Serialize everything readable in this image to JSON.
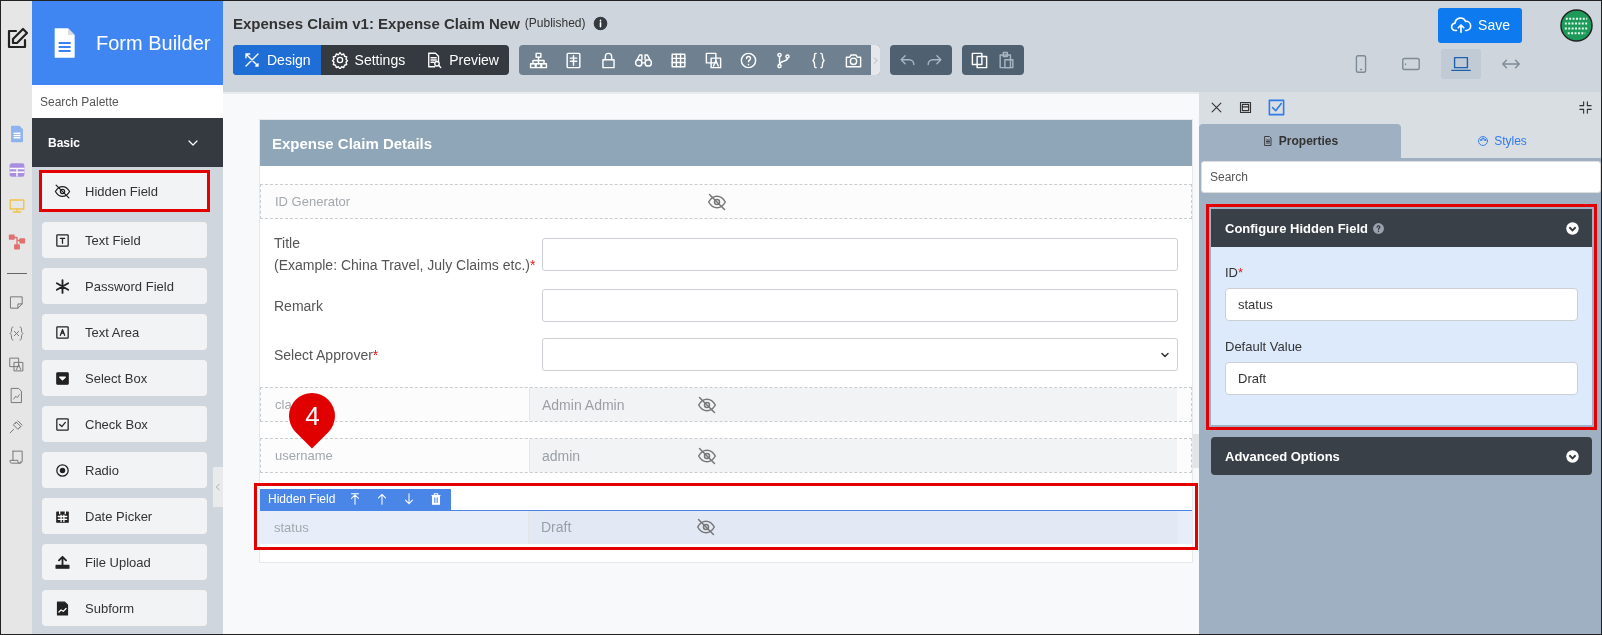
{
  "palette": {
    "title": "Form Builder",
    "search_placeholder": "Search Palette",
    "category": "Basic",
    "items": [
      {
        "label": "Hidden Field",
        "selected": true
      },
      {
        "label": "Text Field",
        "selected": false
      },
      {
        "label": "Password Field",
        "selected": false
      },
      {
        "label": "Text Area",
        "selected": false
      },
      {
        "label": "Select Box",
        "selected": false
      },
      {
        "label": "Check Box",
        "selected": false
      },
      {
        "label": "Radio",
        "selected": false
      },
      {
        "label": "Date Picker",
        "selected": false
      },
      {
        "label": "File Upload",
        "selected": false
      },
      {
        "label": "Subform",
        "selected": false
      }
    ]
  },
  "header": {
    "title": "Expenses Claim v1: Expense Claim New",
    "status": "(Published)"
  },
  "mode_tabs": [
    {
      "label": "Design",
      "selected": true
    },
    {
      "label": "Settings",
      "selected": false
    },
    {
      "label": "Preview",
      "selected": false
    }
  ],
  "save_button": "Save",
  "device_views": [
    {
      "kind": "phone",
      "selected": false
    },
    {
      "kind": "tablet",
      "selected": false
    },
    {
      "kind": "laptop",
      "selected": true
    },
    {
      "kind": "full-width",
      "selected": false
    }
  ],
  "form": {
    "section_title": "Expense Claim Details",
    "selection_toolbar": "Hidden Field",
    "fields": [
      {
        "kind": "hidden",
        "label": "ID Generator",
        "selected": false
      },
      {
        "kind": "text",
        "label": "Title",
        "hint": "(Example: China Travel, July Claims etc.)",
        "required_mark": "*"
      },
      {
        "kind": "text",
        "label": "Remark"
      },
      {
        "kind": "select",
        "label": "Select Approver",
        "required_mark": "*"
      },
      {
        "kind": "hidden",
        "label": "cla",
        "value": "Admin Admin",
        "selected": false
      },
      {
        "kind": "hidden",
        "label": "username",
        "value": "admin",
        "selected": false
      },
      {
        "kind": "hidden",
        "label": "status",
        "value": "Draft",
        "selected": true
      }
    ]
  },
  "callout": "4",
  "properties": {
    "tabs": [
      {
        "label": "Properties",
        "selected": true
      },
      {
        "label": "Styles",
        "selected": false
      }
    ],
    "search_placeholder": "Search",
    "sections": [
      {
        "title": "Configure Hidden Field",
        "expanded": true,
        "highlighted": true,
        "fields": [
          {
            "label": "ID",
            "required_mark": "*",
            "value": "status"
          },
          {
            "label": "Default Value",
            "value": "Draft"
          }
        ]
      },
      {
        "title": "Advanced Options",
        "expanded": false,
        "highlighted": false
      }
    ]
  }
}
